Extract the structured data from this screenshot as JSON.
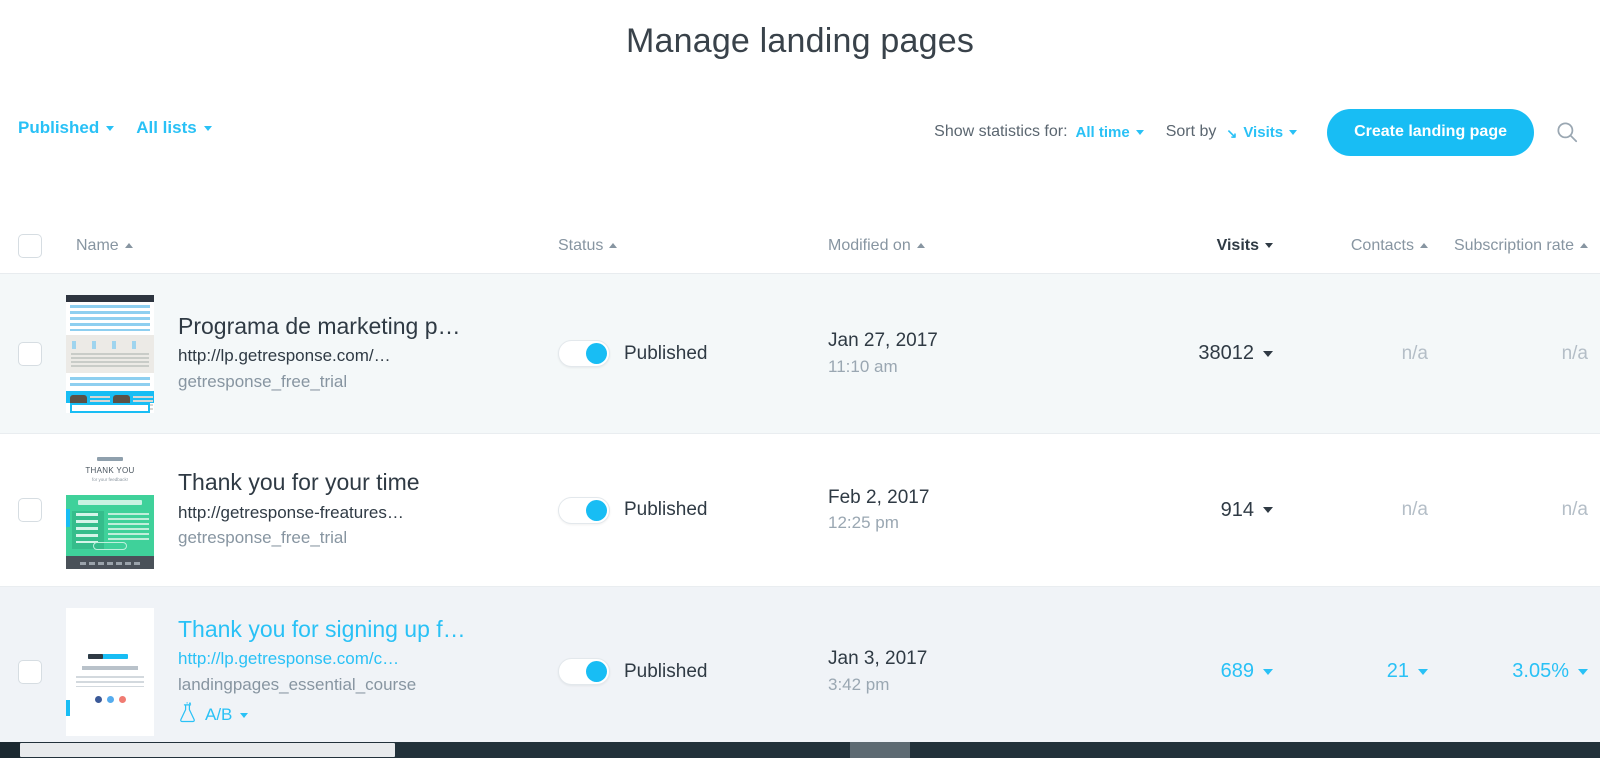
{
  "page": {
    "title": "Manage landing pages"
  },
  "toolbar": {
    "status_filter": "Published",
    "list_filter": "All lists",
    "show_statistics_label": "Show statistics for:",
    "time_range": "All time",
    "sort_by_label": "Sort by",
    "sort_value": "Visits",
    "sort_arrow": "↘",
    "create_button": "Create landing page",
    "search_icon": "search-icon"
  },
  "table": {
    "columns": [
      {
        "key": "name",
        "label": "Name",
        "sort": "asc",
        "active": false
      },
      {
        "key": "status",
        "label": "Status",
        "sort": "asc",
        "active": false
      },
      {
        "key": "modified_on",
        "label": "Modified on",
        "sort": "asc",
        "active": false
      },
      {
        "key": "visits",
        "label": "Visits",
        "sort": "desc",
        "active": true
      },
      {
        "key": "contacts",
        "label": "Contacts",
        "sort": "asc",
        "active": false
      },
      {
        "key": "subscription_rate",
        "label": "Subscription rate",
        "sort": "asc",
        "active": false
      }
    ],
    "rows": [
      {
        "title": "Programa de marketing p…",
        "url": "http://lp.getresponse.com/…",
        "list": "getresponse_free_trial",
        "status": "Published",
        "status_on": true,
        "modified_date": "Jan 27, 2017",
        "modified_time": "11:10 am",
        "visits": "38012",
        "contacts": "n/a",
        "subscription_rate": "n/a",
        "ab_test": null,
        "highlighted": false
      },
      {
        "title": "Thank you for your time",
        "url": "http://getresponse-freatures…",
        "list": "getresponse_free_trial",
        "status": "Published",
        "status_on": true,
        "modified_date": "Feb 2, 2017",
        "modified_time": "12:25 pm",
        "visits": "914",
        "contacts": "n/a",
        "subscription_rate": "n/a",
        "ab_test": null,
        "highlighted": false
      },
      {
        "title": "Thank you for signing up f…",
        "url": "http://lp.getresponse.com/c…",
        "list": "landingpages_essential_course",
        "status": "Published",
        "status_on": true,
        "modified_date": "Jan 3, 2017",
        "modified_time": "3:42 pm",
        "visits": "689",
        "contacts": "21",
        "subscription_rate": "3.05%",
        "ab_test": "A/B",
        "highlighted": true
      }
    ]
  },
  "colors": {
    "accent": "#18bdf4",
    "link": "#29c1f6",
    "text_dark": "#2f3a44",
    "text_muted": "#8795a1",
    "row_shade": "#f4f8f9",
    "row_hover": "#f0f3f7",
    "scrollbar_track": "#22313a"
  }
}
